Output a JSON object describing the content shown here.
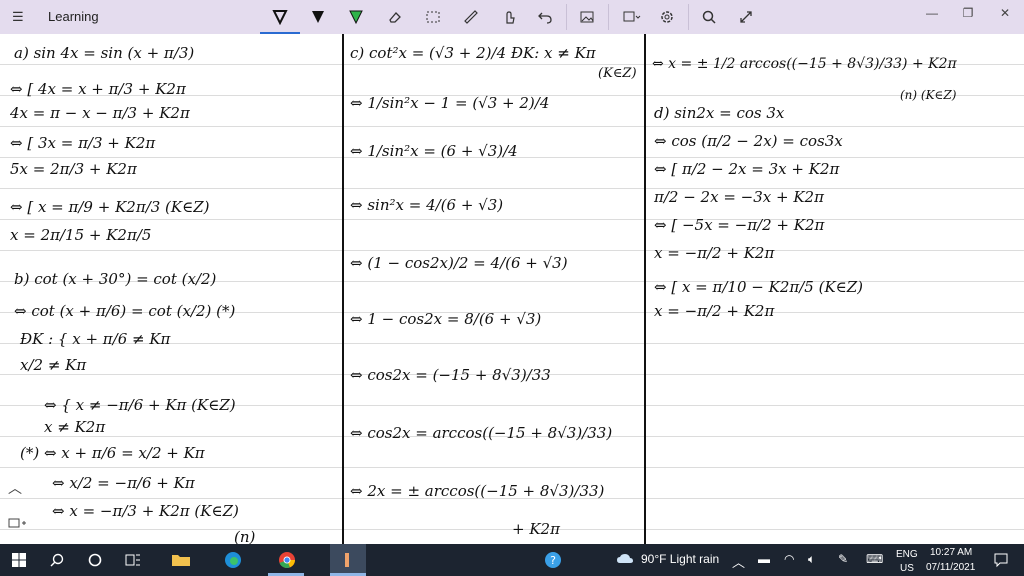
{
  "app": {
    "title": "Learning"
  },
  "toolbar": {
    "tools": [
      {
        "name": "pen-black-icon"
      },
      {
        "name": "pen-black2-icon"
      },
      {
        "name": "pen-green-icon"
      },
      {
        "name": "eraser-icon"
      },
      {
        "name": "lasso-select-icon"
      },
      {
        "name": "ruler-icon"
      },
      {
        "name": "touch-writing-icon"
      },
      {
        "name": "undo-icon"
      },
      {
        "name": "image-icon"
      },
      {
        "name": "shapes-icon"
      },
      {
        "name": "settings-icon"
      },
      {
        "name": "search-icon"
      },
      {
        "name": "expand-icon"
      }
    ]
  },
  "notes": {
    "col1": [
      "a) sin 4x = sin (x + π/3)",
      "⇔ [ 4x = x + π/3 + K2π",
      "    4x = π − x − π/3 + K2π",
      "⇔ [ 3x = π/3 + K2π",
      "    5x = 2π/3 + K2π",
      "⇔ [ x = π/9 + K2π/3   (K∈Z)",
      "    x = 2π/15 + K2π/5",
      "b) cot (x + 30°) = cot (x/2)",
      "⇔ cot (x + π/6) = cot (x/2)  (*)",
      "ĐK : { x + π/6 ≠ Kπ",
      "      x/2 ≠ Kπ",
      "⇔ { x ≠ −π/6 + Kπ   (K∈Z)",
      "    x ≠ K2π",
      "(*) ⇔ x + π/6 = x/2 + Kπ",
      "⇔ x/2 = −π/6 + Kπ",
      "⇔ x = −π/3 + K2π  (K∈Z)",
      "(n)"
    ],
    "col2": [
      "c) cot²x = (√3 + 2)/4    ĐK: x ≠ Kπ",
      "(K∈Z)",
      "⇔ 1/sin²x − 1 = (√3 + 2)/4",
      "⇔ 1/sin²x = (6 + √3)/4",
      "⇔ sin²x = 4/(6 + √3)",
      "⇔ (1 − cos2x)/2 = 4/(6 + √3)",
      "⇔ 1 − cos2x = 8/(6 + √3)",
      "⇔ cos2x = (−15 + 8√3)/33",
      "⇔ cos2x = arccos((−15 + 8√3)/33)",
      "⇔ 2x = ± arccos((−15 + 8√3)/33)",
      "+ K2π"
    ],
    "col3": [
      "⇔ x = ± 1/2 arccos((−15 + 8√3)/33) + K2π",
      "(n)   (K∈Z)",
      "d) sin2x = cos 3x",
      "⇔ cos (π/2 − 2x) = cos3x",
      "⇔ [ π/2 − 2x = 3x + K2π",
      "    π/2 − 2x = −3x + K2π",
      "⇔ [ −5x = −π/2 + K2π",
      "    x = −π/2 + K2π",
      "⇔ [ x = π/10 − K2π/5  (K∈Z)",
      "    x = −π/2 + K2π"
    ]
  },
  "taskbar": {
    "weather": "90°F  Light rain",
    "lang_top": "ENG",
    "lang_bottom": "US",
    "time": "10:27 AM",
    "date": "07/11/2021"
  }
}
